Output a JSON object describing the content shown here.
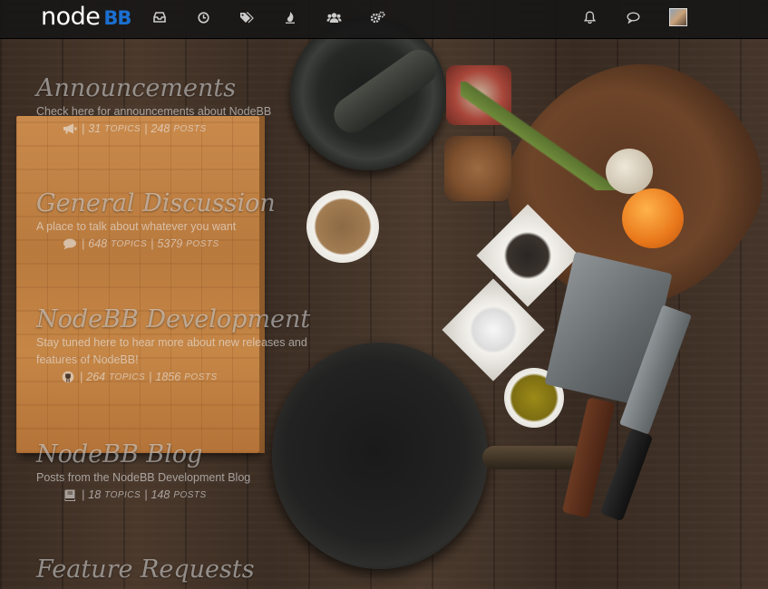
{
  "header": {
    "logo": {
      "word": "node",
      "badge": "BB"
    },
    "nav_icons": [
      "inbox-icon",
      "clock-icon",
      "tags-icon",
      "popular-flame-icon",
      "users-icon",
      "gears-icon"
    ],
    "right_icons": [
      "bell-icon",
      "chat-icon",
      "user-avatar"
    ]
  },
  "categories": [
    {
      "title": "Announcements",
      "description": "Check here for announcements about NodeBB",
      "icon": "bullhorn-icon",
      "topics": "31",
      "posts": "248",
      "topics_label": "TOPICS",
      "posts_label": "POSTS"
    },
    {
      "title": "General Discussion",
      "description": "A place to talk about whatever you want",
      "icon": "comment-icon",
      "topics": "648",
      "posts": "5379",
      "topics_label": "TOPICS",
      "posts_label": "POSTS"
    },
    {
      "title": "NodeBB Development",
      "description": "Stay tuned here to hear more about new releases and features of NodeBB!",
      "icon": "github-icon",
      "topics": "264",
      "posts": "1856",
      "topics_label": "TOPICS",
      "posts_label": "POSTS"
    },
    {
      "title": "NodeBB Blog",
      "description": "Posts from the NodeBB Development Blog",
      "icon": "book-icon",
      "topics": "18",
      "posts": "148",
      "topics_label": "TOPICS",
      "posts_label": "POSTS"
    },
    {
      "title": "Feature Requests"
    }
  ],
  "colors": {
    "logo_accent": "#1b6fd1",
    "topbar": "#161616",
    "category_text": "#e6e6e6"
  }
}
